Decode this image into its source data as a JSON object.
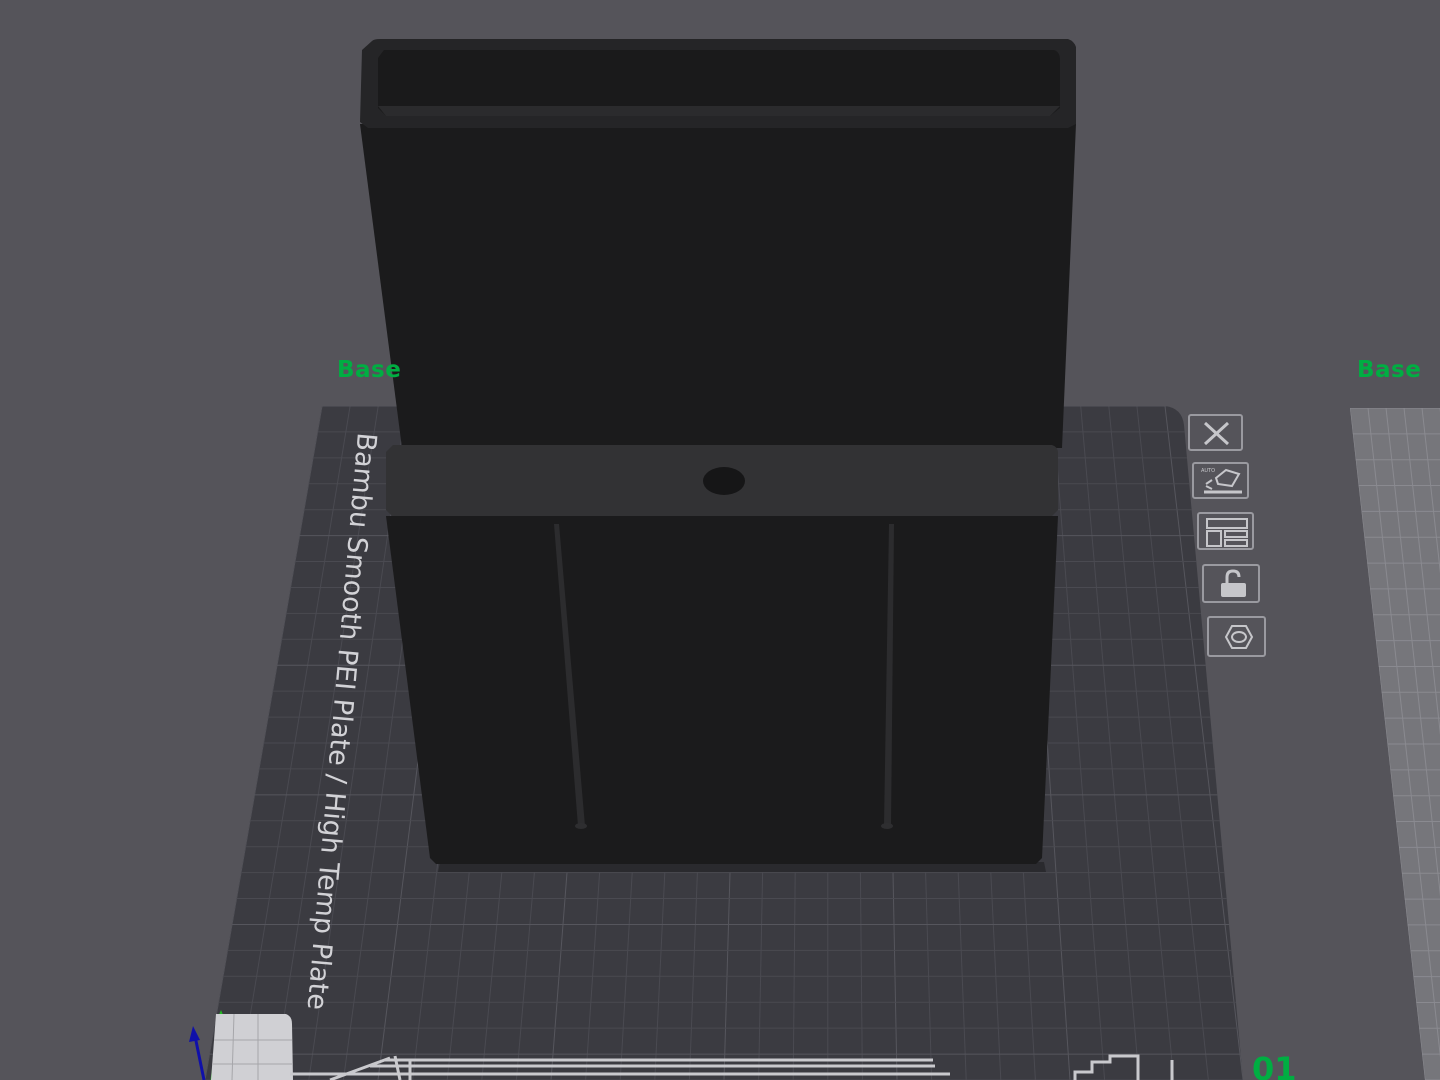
{
  "viewport": {
    "background_color": "#55545a",
    "accent_color": "#00ae42"
  },
  "plates": {
    "main": {
      "name_label": "Base",
      "plate_type_text": "Bambu Smooth PEI Plate / High Temp Plate",
      "index_label": "01"
    },
    "side": {
      "name_label": "Base"
    }
  },
  "plate_toolbar": {
    "buttons": [
      {
        "id": "close",
        "icon": "close-icon"
      },
      {
        "id": "auto-orient",
        "icon": "auto-orient-icon"
      },
      {
        "id": "arrange",
        "icon": "arrange-icon"
      },
      {
        "id": "lock",
        "icon": "lock-icon"
      },
      {
        "id": "plate-settings",
        "icon": "settings-icon"
      }
    ]
  },
  "model": {
    "color": "#1b1b1c",
    "shelf_color": "#323234"
  },
  "axes": {
    "x_color": "#cc0000",
    "y_color": "#22bb22",
    "z_color": "#1010aa"
  }
}
